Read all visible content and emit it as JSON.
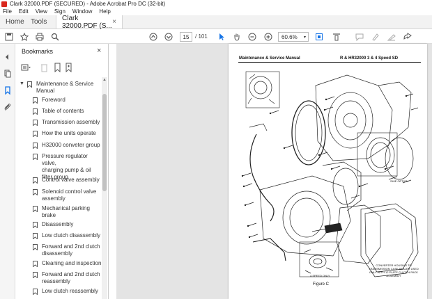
{
  "window": {
    "title": "Clark 32000.PDF (SECURED) - Adobe Acrobat Pro DC (32-bit)"
  },
  "menu": {
    "items": [
      "File",
      "Edit",
      "View",
      "Sign",
      "Window",
      "Help"
    ]
  },
  "tabs": {
    "home": "Home",
    "tools": "Tools",
    "document": "Clark 32000.PDF (S...",
    "close": "×"
  },
  "toolbar": {
    "page_current": "15",
    "page_total": "/ 101",
    "zoom": "60.6%",
    "icons": [
      "save-icon",
      "bookmark-star-icon",
      "print-icon",
      "search-icon",
      "prev-page-icon",
      "next-page-icon",
      "select-cursor-icon",
      "hand-icon",
      "zoom-out-icon",
      "zoom-in-icon",
      "fit-page-icon",
      "scroll-mode-icon",
      "comment-icon",
      "highlight-icon",
      "sign-icon",
      "share-icon"
    ]
  },
  "bookmarks_panel": {
    "title": "Bookmarks",
    "close": "×",
    "items": [
      {
        "label_lines": [
          "Maintenance & Service",
          "Manual"
        ],
        "expanded": true
      },
      {
        "label_lines": [
          "Foreword"
        ]
      },
      {
        "label_lines": [
          "Table of contents"
        ]
      },
      {
        "label_lines": [
          "Transmission assembly"
        ]
      },
      {
        "label_lines": [
          "How the units operate"
        ]
      },
      {
        "label_lines": [
          "H32000 conveter group"
        ]
      },
      {
        "label_lines": [
          "Pressure regulator valve,",
          "charging pump & oil",
          "filter group"
        ]
      },
      {
        "label_lines": [
          "Control valve assembly"
        ]
      },
      {
        "label_lines": [
          "Solenoid control valve",
          "assembly"
        ]
      },
      {
        "label_lines": [
          "Mechanical parking",
          "brake"
        ]
      },
      {
        "label_lines": [
          "Disassembly"
        ]
      },
      {
        "label_lines": [
          "Low clutch disassembly"
        ]
      },
      {
        "label_lines": [
          "Forward and 2nd clutch",
          "disassembly"
        ]
      },
      {
        "label_lines": [
          "Cleaning and inspection"
        ]
      },
      {
        "label_lines": [
          "Forward and 2nd clutch",
          "reassembly"
        ]
      },
      {
        "label_lines": [
          "Low clutch reassembly"
        ]
      }
    ]
  },
  "document_page": {
    "header_left": "Maintenance & Service Manual",
    "header_right": "R & HR32000 3 & 4 Speed SD",
    "figure_caption": "Figure C",
    "inset_label_1": "SHIE OPTION",
    "inset_label_2": "4 SPEED ONLY",
    "inset_note": "CONVERTER HOUSING TO TRANSMISSION CASE SEALER USED ONLY WITH 12 PLATE CLUTCH PACK ASSEMBLY"
  }
}
